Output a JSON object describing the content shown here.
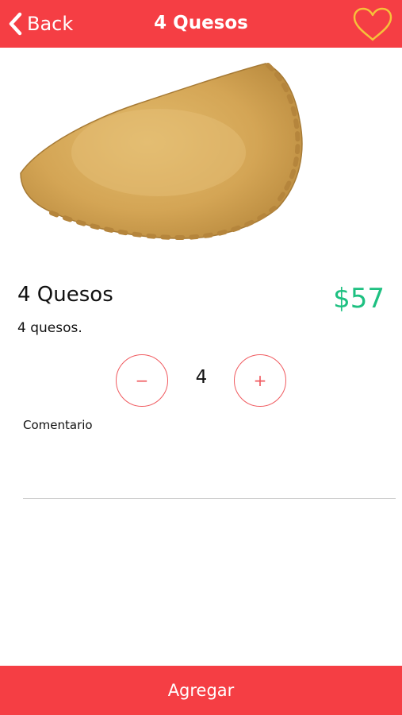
{
  "header": {
    "back_label": "Back",
    "title": "4 Quesos",
    "favorite_icon": "heart-outline-icon",
    "accent_color": "#f53e44",
    "heart_color": "#f6c13a"
  },
  "product": {
    "image_alt": "empanada",
    "name": "4 Quesos",
    "price": "$57",
    "price_color": "#1ec081",
    "description": "4 quesos."
  },
  "quantity": {
    "minus_symbol": "−",
    "plus_symbol": "+",
    "value": "4"
  },
  "comment": {
    "label": "Comentario",
    "value": "",
    "placeholder": ""
  },
  "footer": {
    "add_label": "Agregar"
  }
}
